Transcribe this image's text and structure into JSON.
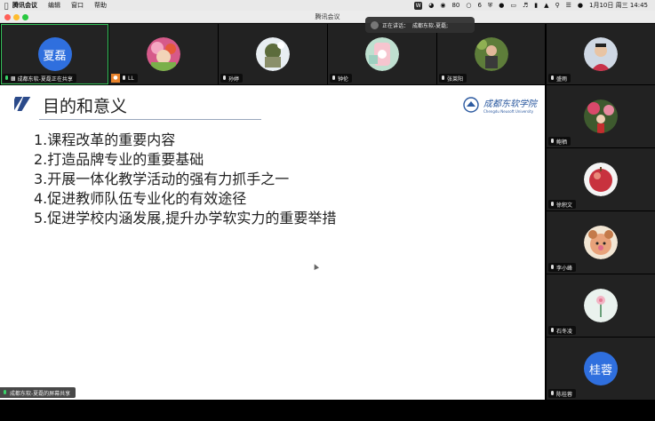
{
  "menubar": {
    "app": "腾讯会议",
    "menus": [
      "编辑",
      "窗口",
      "帮助"
    ],
    "status_num1": "80",
    "status_num2": "6",
    "datetime": "1月10日 周三  14:45"
  },
  "window": {
    "title": "腾讯会议"
  },
  "speaking_toast": {
    "label": "正在讲话：",
    "name": "成都东软-夏磊;"
  },
  "top_participants": [
    {
      "name": "成都东软-夏磊正在共享",
      "avatar_text": "夏磊"
    },
    {
      "name": "LL"
    },
    {
      "name": "孙婷"
    },
    {
      "name": "钟伦"
    },
    {
      "name": ""
    },
    {
      "name": "张莱阳"
    },
    {
      "name": "盛雨"
    }
  ],
  "side_participants": [
    {
      "name": "鲍栖"
    },
    {
      "name": "徐积文"
    },
    {
      "name": "李小峰"
    },
    {
      "name": "石冬凌"
    },
    {
      "name": "陈桂蓉",
      "avatar_text": "桂蓉"
    }
  ],
  "slide": {
    "title": "目的和意义",
    "brand_main": "成都东软学院",
    "brand_sub": "Chengdu Neusoft University",
    "items": [
      "1.课程改革的重要内容",
      "2.打造品牌专业的重要基础",
      "3.开展一体化教学活动的强有力抓手之一",
      "4.促进教师队伍专业化的有效途径",
      "5.促进学校内涵发展,提升办学软实力的重要举措"
    ]
  },
  "share_label": "成都东软-夏磊的屏幕共享",
  "colors": {
    "accent_blue": "#2f6fde",
    "active_green": "#35c25a"
  }
}
